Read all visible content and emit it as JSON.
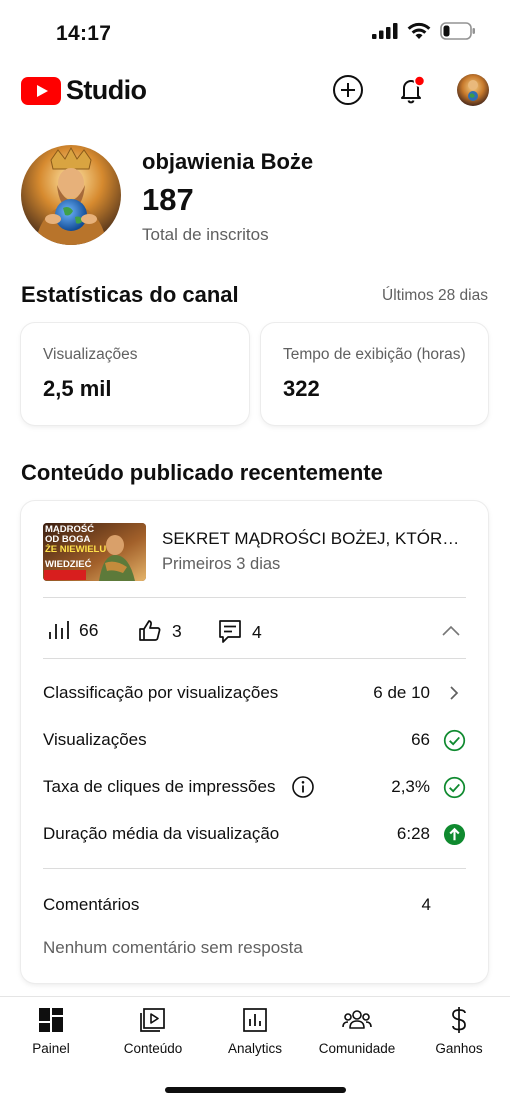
{
  "status_bar": {
    "time": "14:17"
  },
  "header": {
    "logo_text": "Studio",
    "brand_color": "#ff0000",
    "create_icon": "plus-circle-icon",
    "notifications_icon": "bell-icon",
    "notification_dot_color": "#ff0000",
    "account_icon": "avatar"
  },
  "channel": {
    "name": "objawienia Boże",
    "subscribers": "187",
    "subscribers_label": "Total de inscritos"
  },
  "stats": {
    "title": "Estatísticas do canal",
    "period": "Últimos 28 dias",
    "cards": [
      {
        "label": "Visualizações",
        "value": "2,5 mil"
      },
      {
        "label": "Tempo de exibição (horas)",
        "value": "322"
      }
    ]
  },
  "recent": {
    "title": "Conteúdo publicado recentemente",
    "video": {
      "thumbnail_text": [
        "MĄDROŚĆ",
        "OD BOGA",
        "ŻE NIEWIELU",
        "WIEDZIEĆ"
      ],
      "title": "SEKRET MĄDROŚCI BOŻEJ, KTÓRĄ NIEWIELU ZNA",
      "subtitle": "Primeiros 3 dias"
    },
    "metrics": {
      "views": "66",
      "likes": "3",
      "comments": "4"
    },
    "rows": [
      {
        "label": "Classificação por visualizações",
        "value": "6 de 10",
        "icon": "chevron-right-icon"
      },
      {
        "label": "Visualizações",
        "value": "66",
        "icon": "check-circle-icon"
      },
      {
        "label": "Taxa de cliques de impressões",
        "value": "2,3%",
        "icon": "check-circle-icon",
        "info_icon": "info-icon"
      },
      {
        "label": "Duração média da visualização",
        "value": "6:28",
        "icon": "arrow-up-circle-icon"
      }
    ],
    "comments": {
      "label": "Comentários",
      "count": "4",
      "note": "Nenhum comentário sem resposta"
    },
    "success_color": "#0f8a2f"
  },
  "nav": [
    {
      "label": "Painel",
      "icon": "dashboard-icon",
      "active": true
    },
    {
      "label": "Conteúdo",
      "icon": "content-icon"
    },
    {
      "label": "Analytics",
      "icon": "analytics-icon"
    },
    {
      "label": "Comunidade",
      "icon": "community-icon"
    },
    {
      "label": "Ganhos",
      "icon": "dollar-icon"
    }
  ]
}
